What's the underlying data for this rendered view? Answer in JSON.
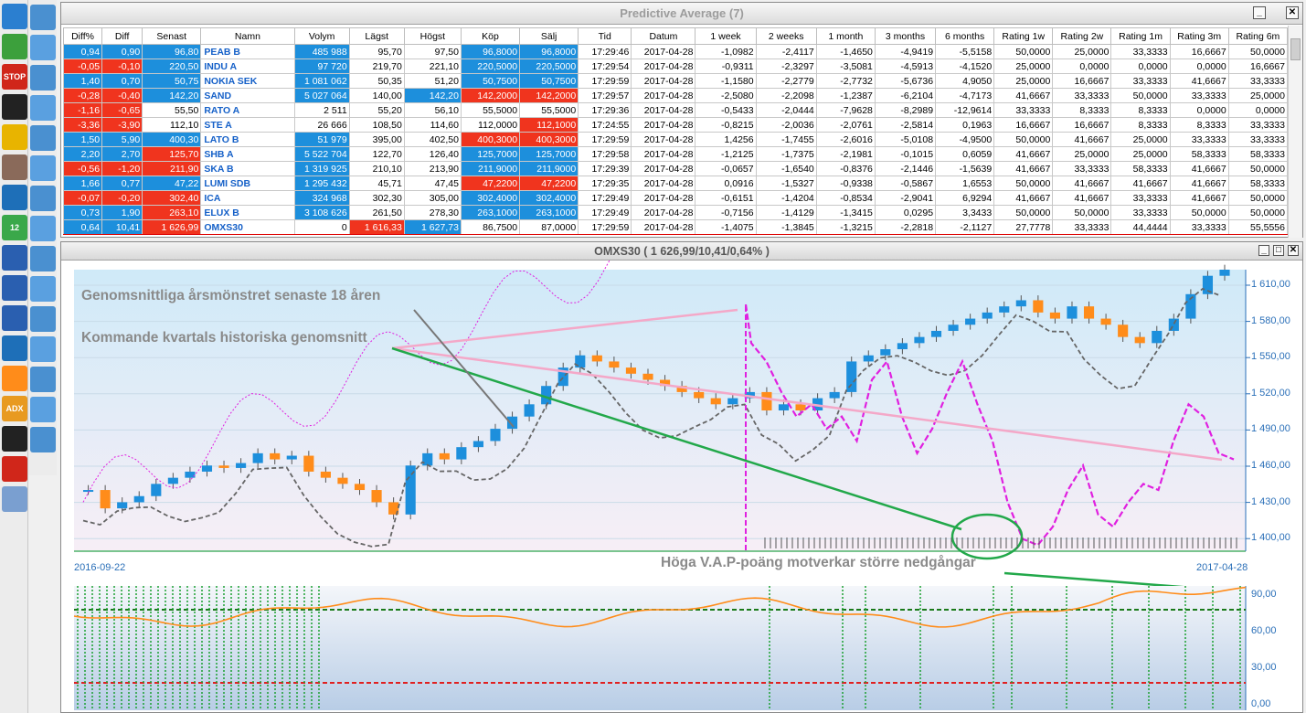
{
  "toolbar1": [
    "wrench-icon",
    "chart-bars-icon",
    "stop-icon",
    "yin-yang-icon",
    "pin-icon",
    "avatar",
    "spiral-icon",
    "calendar-icon",
    "compass-icon",
    "compass-w-icon",
    "compass-red-icon",
    "anchor-icon",
    "line-indicator-icon",
    "adx-icon",
    "wave-icon",
    "alarm-icon",
    "document-icon"
  ],
  "toolbar1_labels": {
    "stop": "STOP",
    "calendar": "12",
    "adx": "ADX"
  },
  "grid": {
    "title": "Predictive Average (7)",
    "columns": [
      "Diff%",
      "Diff",
      "Senast",
      "Namn",
      "Volym",
      "Lägst",
      "Högst",
      "Köp",
      "Sälj",
      "Tid",
      "Datum",
      "1 week",
      "2 weeks",
      "1 month",
      "3 months",
      "6 months",
      "Rating 1w",
      "Rating 2w",
      "Rating 1m",
      "Rating 3m",
      "Rating 6m"
    ],
    "rows": [
      [
        "0,94",
        "0,90",
        "96,80",
        "PEAB B",
        "485 988",
        "95,70",
        "97,50",
        "96,8000",
        "96,8000",
        "17:29:46",
        "2017-04-28",
        "-1,0982",
        "-2,4117",
        "-1,4650",
        "-4,9419",
        "-5,5158",
        "50,0000",
        "25,0000",
        "33,3333",
        "16,6667",
        "50,0000"
      ],
      [
        "-0,05",
        "-0,10",
        "220,50",
        "INDU A",
        "97 720",
        "219,70",
        "221,10",
        "220,5000",
        "220,5000",
        "17:29:54",
        "2017-04-28",
        "-0,9311",
        "-2,3297",
        "-3,5081",
        "-4,5913",
        "-4,1520",
        "25,0000",
        "0,0000",
        "0,0000",
        "0,0000",
        "16,6667"
      ],
      [
        "1,40",
        "0,70",
        "50,75",
        "NOKIA SEK",
        "1 081 062",
        "50,35",
        "51,20",
        "50,7500",
        "50,7500",
        "17:29:59",
        "2017-04-28",
        "-1,1580",
        "-2,2779",
        "-2,7732",
        "-5,6736",
        "4,9050",
        "25,0000",
        "16,6667",
        "33,3333",
        "41,6667",
        "33,3333"
      ],
      [
        "-0,28",
        "-0,40",
        "142,20",
        "SAND",
        "5 027 064",
        "140,00",
        "142,20",
        "142,2000",
        "142,2000",
        "17:29:57",
        "2017-04-28",
        "-2,5080",
        "-2,2098",
        "-1,2387",
        "-6,2104",
        "-4,7173",
        "41,6667",
        "33,3333",
        "50,0000",
        "33,3333",
        "25,0000"
      ],
      [
        "-1,16",
        "-0,65",
        "55,50",
        "RATO A",
        "2 511",
        "55,20",
        "56,10",
        "55,5000",
        "55,5000",
        "17:29:36",
        "2017-04-28",
        "-0,5433",
        "-2,0444",
        "-7,9628",
        "-8,2989",
        "-12,9614",
        "33,3333",
        "8,3333",
        "8,3333",
        "0,0000",
        "0,0000"
      ],
      [
        "-3,36",
        "-3,90",
        "112,10",
        "STE A",
        "26 666",
        "108,50",
        "114,60",
        "112,0000",
        "112,1000",
        "17:24:55",
        "2017-04-28",
        "-0,8215",
        "-2,0036",
        "-2,0761",
        "-2,5814",
        "0,1963",
        "16,6667",
        "16,6667",
        "8,3333",
        "8,3333",
        "33,3333"
      ],
      [
        "1,50",
        "5,90",
        "400,30",
        "LATO B",
        "51 979",
        "395,00",
        "402,50",
        "400,3000",
        "400,3000",
        "17:29:59",
        "2017-04-28",
        "1,4256",
        "-1,7455",
        "-2,6016",
        "-5,0108",
        "-4,9500",
        "50,0000",
        "41,6667",
        "25,0000",
        "33,3333",
        "33,3333"
      ],
      [
        "2,20",
        "2,70",
        "125,70",
        "SHB A",
        "5 522 704",
        "122,70",
        "126,40",
        "125,7000",
        "125,7000",
        "17:29:58",
        "2017-04-28",
        "-1,2125",
        "-1,7375",
        "-2,1981",
        "-0,1015",
        "0,6059",
        "41,6667",
        "25,0000",
        "25,0000",
        "58,3333",
        "58,3333"
      ],
      [
        "-0,56",
        "-1,20",
        "211,90",
        "SKA B",
        "1 319 925",
        "210,10",
        "213,90",
        "211,9000",
        "211,9000",
        "17:29:39",
        "2017-04-28",
        "-0,0657",
        "-1,6540",
        "-0,8376",
        "-2,1446",
        "-1,5639",
        "41,6667",
        "33,3333",
        "58,3333",
        "41,6667",
        "50,0000"
      ],
      [
        "1,66",
        "0,77",
        "47,22",
        "LUMI SDB",
        "1 295 432",
        "45,71",
        "47,45",
        "47,2200",
        "47,2200",
        "17:29:35",
        "2017-04-28",
        "0,0916",
        "-1,5327",
        "-0,9338",
        "-0,5867",
        "1,6553",
        "50,0000",
        "41,6667",
        "41,6667",
        "41,6667",
        "58,3333"
      ],
      [
        "-0,07",
        "-0,20",
        "302,40",
        "ICA",
        "324 968",
        "302,30",
        "305,00",
        "302,4000",
        "302,4000",
        "17:29:49",
        "2017-04-28",
        "-0,6151",
        "-1,4204",
        "-0,8534",
        "-2,9041",
        "6,9294",
        "41,6667",
        "41,6667",
        "33,3333",
        "41,6667",
        "50,0000"
      ],
      [
        "0,73",
        "1,90",
        "263,10",
        "ELUX B",
        "3 108 626",
        "261,50",
        "278,30",
        "263,1000",
        "263,1000",
        "17:29:49",
        "2017-04-28",
        "-0,7156",
        "-1,4129",
        "-1,3415",
        "0,0295",
        "3,3433",
        "50,0000",
        "50,0000",
        "33,3333",
        "50,0000",
        "50,0000"
      ],
      [
        "0,64",
        "10,41",
        "1 626,99",
        "OMXS30",
        "0",
        "1 616,33",
        "1 627,73",
        "86,7500",
        "87,0000",
        "17:29:59",
        "2017-04-28",
        "-1,4075",
        "-1,3845",
        "-1,3215",
        "-2,2818",
        "-2,1127",
        "27,7778",
        "33,3333",
        "44,4444",
        "33,3333",
        "55,5556"
      ]
    ],
    "cell_colors": [
      [
        "b",
        "b",
        "b",
        "",
        "b",
        "",
        "",
        "b",
        "b"
      ],
      [
        "r",
        "r",
        "b",
        "",
        "b",
        "",
        "",
        "b",
        "b"
      ],
      [
        "b",
        "b",
        "b",
        "",
        "b",
        "",
        "",
        "b",
        "b"
      ],
      [
        "r",
        "r",
        "b",
        "",
        "b",
        "",
        "b",
        "r",
        "r"
      ],
      [
        "r",
        "r",
        "",
        "",
        "",
        "",
        "",
        "",
        ""
      ],
      [
        "r",
        "r",
        "",
        "",
        "",
        "",
        "",
        "",
        "r"
      ],
      [
        "b",
        "b",
        "b",
        "",
        "b",
        "",
        "",
        "r",
        "r"
      ],
      [
        "b",
        "b",
        "r",
        "",
        "b",
        "",
        "",
        "b",
        "b"
      ],
      [
        "r",
        "r",
        "r",
        "",
        "b",
        "",
        "",
        "b",
        "b"
      ],
      [
        "b",
        "b",
        "b",
        "",
        "b",
        "",
        "",
        "r",
        "r"
      ],
      [
        "r",
        "r",
        "r",
        "",
        "b",
        "",
        "",
        "b",
        "b"
      ],
      [
        "b",
        "b",
        "r",
        "",
        "b",
        "",
        "",
        "b",
        "b"
      ],
      [
        "b",
        "b",
        "r",
        "",
        "",
        "r",
        "b",
        "",
        ""
      ]
    ],
    "selected_row": 12
  },
  "chart": {
    "title": "OMXS30 ( 1 626,99/10,41/0,64% )",
    "annotation1": "Genomsnittliga årsmönstret senaste 18 åren",
    "annotation2": "Kommande kvartals historiska genomsnitt",
    "annotation3": "Höga V.A.P-poäng motverkar större nedgångar",
    "date_start": "2016-09-22",
    "date_end": "2017-04-28",
    "y_ticks": [
      "1 610,00",
      "1 580,00",
      "1 550,00",
      "1 520,00",
      "1 490,00",
      "1 460,00",
      "1 430,00",
      "1 400,00"
    ],
    "lower_y_ticks": [
      "90,00",
      "60,00",
      "30,00",
      "0,00"
    ],
    "colors": {
      "up": "#1d8fdc",
      "down": "#ff8c1a",
      "avg": "#e020e0",
      "hist": "#666666",
      "trend_pink": "#f4a8c8",
      "trend_green": "#22a84a",
      "vap": "#ff8c1a"
    }
  },
  "chart_data": {
    "type": "line",
    "y_axis_range": [
      1390,
      1620
    ],
    "series": [
      {
        "values": [
          1440,
          1425,
          1430,
          1435,
          1445,
          1450,
          1455,
          1460,
          1458,
          1462,
          1470,
          1465,
          1468,
          1455,
          1450,
          1445,
          1440,
          1430,
          1420,
          1460,
          1470,
          1465,
          1475,
          1480,
          1490,
          1500,
          1510,
          1525,
          1540,
          1550,
          1545,
          1540,
          1535,
          1530,
          1525,
          1520,
          1515,
          1510,
          1515,
          1520,
          1505,
          1510,
          1505,
          1515,
          1520,
          1545,
          1550,
          1555,
          1560,
          1565,
          1570,
          1575,
          1580,
          1585,
          1590,
          1595,
          1585,
          1580,
          1590,
          1580,
          1575,
          1565,
          1560,
          1570,
          1580,
          1600,
          1615,
          1620
        ]
      }
    ]
  }
}
